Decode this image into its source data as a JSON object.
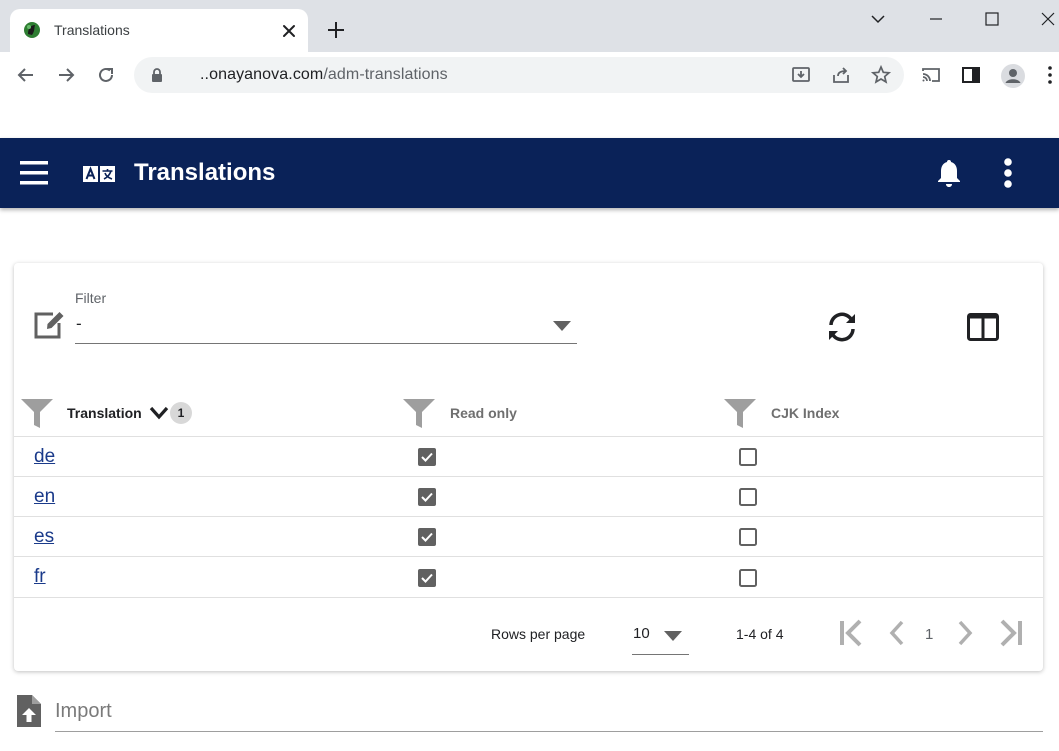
{
  "browser": {
    "tab_title": "Translations",
    "url_host": "..onayanova.com",
    "url_path": "/adm-translations"
  },
  "app": {
    "title": "Translations"
  },
  "filter": {
    "label": "Filter",
    "value": "-"
  },
  "table": {
    "columns": {
      "translation": "Translation",
      "read_only": "Read only",
      "cjk_index": "CJK Index"
    },
    "sort_badge": "1",
    "rows": [
      {
        "translation": "de",
        "read_only": true,
        "cjk_index": false
      },
      {
        "translation": "en",
        "read_only": true,
        "cjk_index": false
      },
      {
        "translation": "es",
        "read_only": true,
        "cjk_index": false
      },
      {
        "translation": "fr",
        "read_only": true,
        "cjk_index": false
      }
    ]
  },
  "pagination": {
    "rows_per_page_label": "Rows per page",
    "rows_per_page": "10",
    "range": "1-4 of 4",
    "page": "1"
  },
  "import": {
    "placeholder": "Import"
  },
  "colors": {
    "appbar": "#0a2258",
    "link": "#1a3a8a",
    "checkbox_checked": "#616161"
  }
}
